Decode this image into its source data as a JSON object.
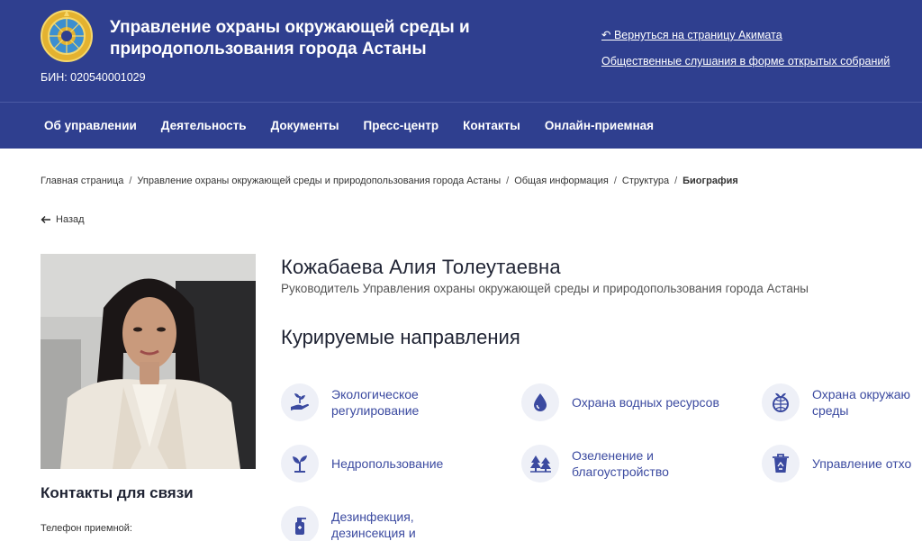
{
  "header": {
    "org_line1": "Управление охраны окружающей среды и",
    "org_line2": "природопользования города Астаны",
    "bin": "БИН: 020540001029",
    "links": [
      "↶ Вернуться на страницу Акимата",
      "Общественные слушания в форме открытых собраний"
    ]
  },
  "nav": {
    "items": [
      "Об управлении",
      "Деятельность",
      "Документы",
      "Пресс-центр",
      "Контакты",
      "Онлайн-приемная"
    ]
  },
  "breadcrumb": {
    "items": [
      "Главная страница",
      "Управление охраны окружающей среды и природопользования города Астаны",
      "Общая информация",
      "Структура",
      "Биография"
    ]
  },
  "back_label": "Назад",
  "person": {
    "name": "Кожабаева Алия Толеутаевна",
    "role": "Руководитель Управления охраны окружающей среды и природопользования города Астаны"
  },
  "directions": {
    "title": "Курируемые направления",
    "items": [
      {
        "line1": "Экологическое",
        "line2": "регулирование",
        "icon": "hand-plant-icon"
      },
      {
        "line1": "Охрана водных ресурсов",
        "line2": "",
        "icon": "water-drop-icon"
      },
      {
        "line1": "Охрана окружаю",
        "line2": "среды",
        "icon": "globe-plant-icon"
      },
      {
        "line1": "Недропользование",
        "line2": "",
        "icon": "sprout-icon"
      },
      {
        "line1": "Озеленение и",
        "line2": "благоустройство",
        "icon": "trees-icon"
      },
      {
        "line1": "Управление отхо",
        "line2": "",
        "icon": "recycle-bin-icon"
      },
      {
        "line1": "Дезинфекция,",
        "line2": "дезинсекция и",
        "icon": "spray-bottle-icon"
      }
    ]
  },
  "contacts": {
    "title": "Контакты для связи",
    "phone_label": "Телефон приемной:"
  },
  "colors": {
    "header_bg": "#2f3f8f",
    "accent": "#3b4aa0"
  }
}
